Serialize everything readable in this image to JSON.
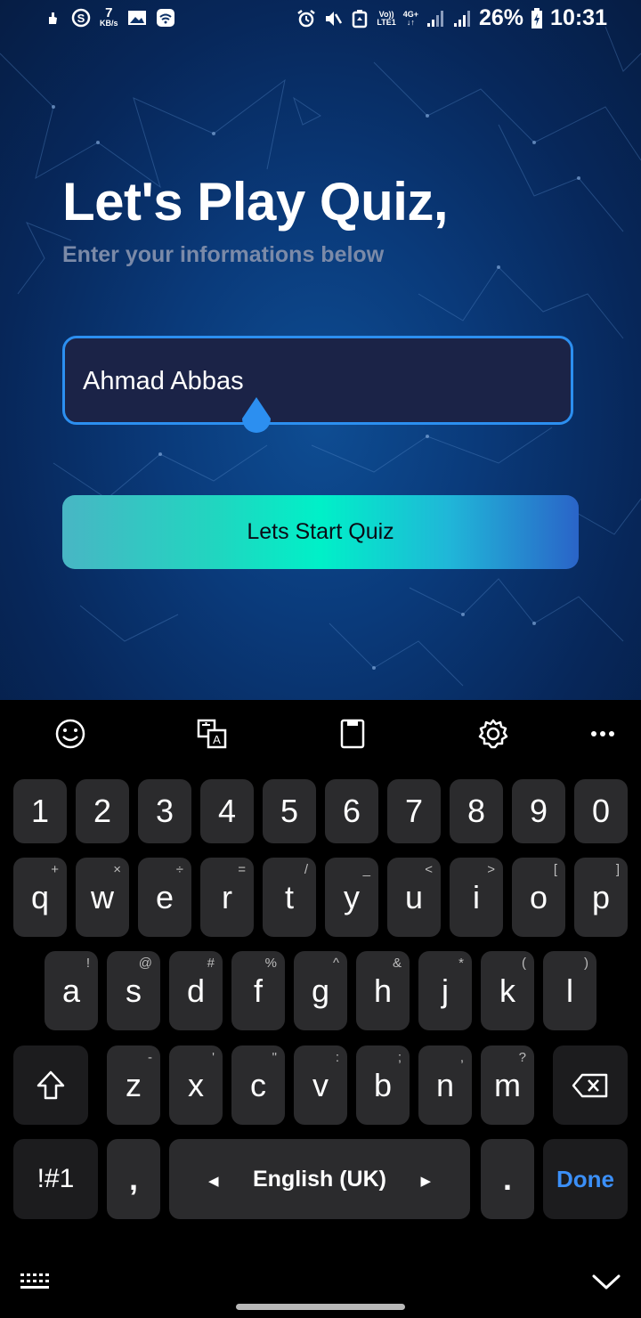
{
  "status_bar": {
    "net_speed_value": "7",
    "net_speed_unit": "KB/s",
    "volte_top": "Vo))",
    "volte_bottom": "LTE1",
    "network_type": "4G+",
    "battery_percent": "26%",
    "time": "10:31",
    "icons_left": [
      "hand-icon",
      "s-circle-icon",
      "image-icon",
      "wifi-icon"
    ],
    "icons_right": [
      "alarm-icon",
      "mute-icon",
      "recycle-icon",
      "volte-icon",
      "signal-icon",
      "signal-icon",
      "battery-charging-icon"
    ]
  },
  "screen": {
    "title": "Let's Play Quiz,",
    "subtitle": "Enter your informations below",
    "name_input": {
      "value": "Ahmad Abbas"
    },
    "start_button_label": "Lets Start Quiz"
  },
  "colors": {
    "background_top": "#061d44",
    "background_mid": "#0e4d93",
    "input_border": "#2c8ff0",
    "input_fill": "#1b2347",
    "button_gradient": [
      "#48b6c4",
      "#00f0c8",
      "#2a64c8"
    ],
    "keyboard_bg": "#000000",
    "key_bg": "#2b2b2d",
    "done_text": "#3b8ff7"
  },
  "keyboard": {
    "toolbar": [
      "emoji-icon",
      "translate-icon",
      "clipboard-icon",
      "settings-icon",
      "more-icon"
    ],
    "row_numbers": [
      "1",
      "2",
      "3",
      "4",
      "5",
      "6",
      "7",
      "8",
      "9",
      "0"
    ],
    "row_q": [
      {
        "k": "q",
        "s": "+"
      },
      {
        "k": "w",
        "s": "×"
      },
      {
        "k": "e",
        "s": "÷"
      },
      {
        "k": "r",
        "s": "="
      },
      {
        "k": "t",
        "s": "/"
      },
      {
        "k": "y",
        "s": "_"
      },
      {
        "k": "u",
        "s": "<"
      },
      {
        "k": "i",
        "s": ">"
      },
      {
        "k": "o",
        "s": "["
      },
      {
        "k": "p",
        "s": "]"
      }
    ],
    "row_a": [
      {
        "k": "a",
        "s": "!"
      },
      {
        "k": "s",
        "s": "@"
      },
      {
        "k": "d",
        "s": "#"
      },
      {
        "k": "f",
        "s": "%"
      },
      {
        "k": "g",
        "s": "^"
      },
      {
        "k": "h",
        "s": "&"
      },
      {
        "k": "j",
        "s": "*"
      },
      {
        "k": "k",
        "s": "("
      },
      {
        "k": "l",
        "s": ")"
      }
    ],
    "row_z": [
      {
        "k": "z",
        "s": "-"
      },
      {
        "k": "x",
        "s": "'"
      },
      {
        "k": "c",
        "s": "\""
      },
      {
        "k": "v",
        "s": ":"
      },
      {
        "k": "b",
        "s": ";"
      },
      {
        "k": "n",
        "s": ","
      },
      {
        "k": "m",
        "s": "?"
      }
    ],
    "symbols_label": "!#1",
    "comma_label": ",",
    "space_label": "English (UK)",
    "period_label": ".",
    "done_label": "Done"
  }
}
